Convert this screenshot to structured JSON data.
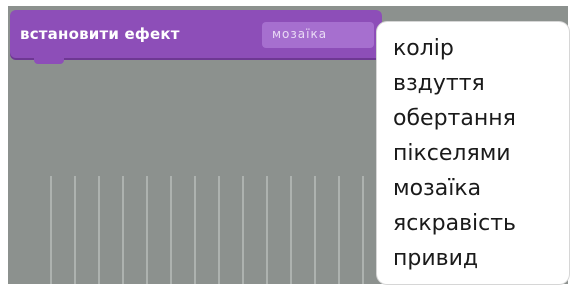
{
  "block": {
    "label": "встановити ефект",
    "selected_effect": "мозаїка"
  },
  "dropdown": {
    "options": [
      "колір",
      "вздуття",
      "обертання",
      "пікселями",
      "мозаїка",
      "яскравість",
      "привид"
    ]
  },
  "colors": {
    "block": "#8d4eb8",
    "field": "#a66fcf",
    "workspace": "#8c918e",
    "menu_bg": "#ffffff"
  }
}
